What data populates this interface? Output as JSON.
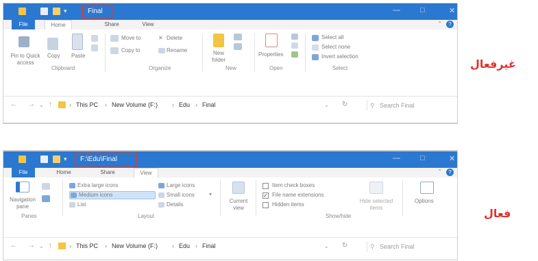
{
  "labels": {
    "inactive": "غيرفعال",
    "active": "فعال"
  },
  "top": {
    "title": "Final",
    "tabs": [
      "File",
      "Home",
      "Share",
      "View"
    ],
    "ribbon": {
      "pin": "Pin to Quick access",
      "copy": "Copy",
      "paste": "Paste",
      "move_to": "Move to",
      "copy_to": "Copy to",
      "delete": "Delete",
      "rename": "Rename",
      "new_folder": "New folder",
      "properties": "Properties",
      "select_all": "Select all",
      "select_none": "Select none",
      "invert_selection": "Invert selection",
      "groups": [
        "Clipboard",
        "Organize",
        "New",
        "Open",
        "Select"
      ]
    },
    "address": {
      "this_pc": "This PC",
      "volume": "New Volume (F:)",
      "edu": "Edu",
      "final": "Final",
      "search_placeholder": "Search Final"
    }
  },
  "bottom": {
    "title": "F:\\Edu\\Final",
    "tabs": [
      "File",
      "Home",
      "Share",
      "View"
    ],
    "ribbon": {
      "navigation_pane": "Navigation pane",
      "extra_large": "Extra large icons",
      "large": "Large icons",
      "medium": "Medium icons",
      "small": "Small icons",
      "list": "List",
      "details": "Details",
      "current_view": "Current view",
      "item_checkboxes": "Item check boxes",
      "file_name_extensions": "File name extensions",
      "hidden_items": "Hidden items",
      "hide_selected": "Hide selected items",
      "options": "Options",
      "groups": [
        "Panes",
        "Layout",
        "Show/hide"
      ]
    },
    "address": {
      "this_pc": "This PC",
      "volume": "New Volume (F:)",
      "edu": "Edu",
      "final": "Final",
      "search_placeholder": "Search Final"
    }
  },
  "colors": {
    "accent": "#2b78d0",
    "highlight": "#e03b2b"
  }
}
